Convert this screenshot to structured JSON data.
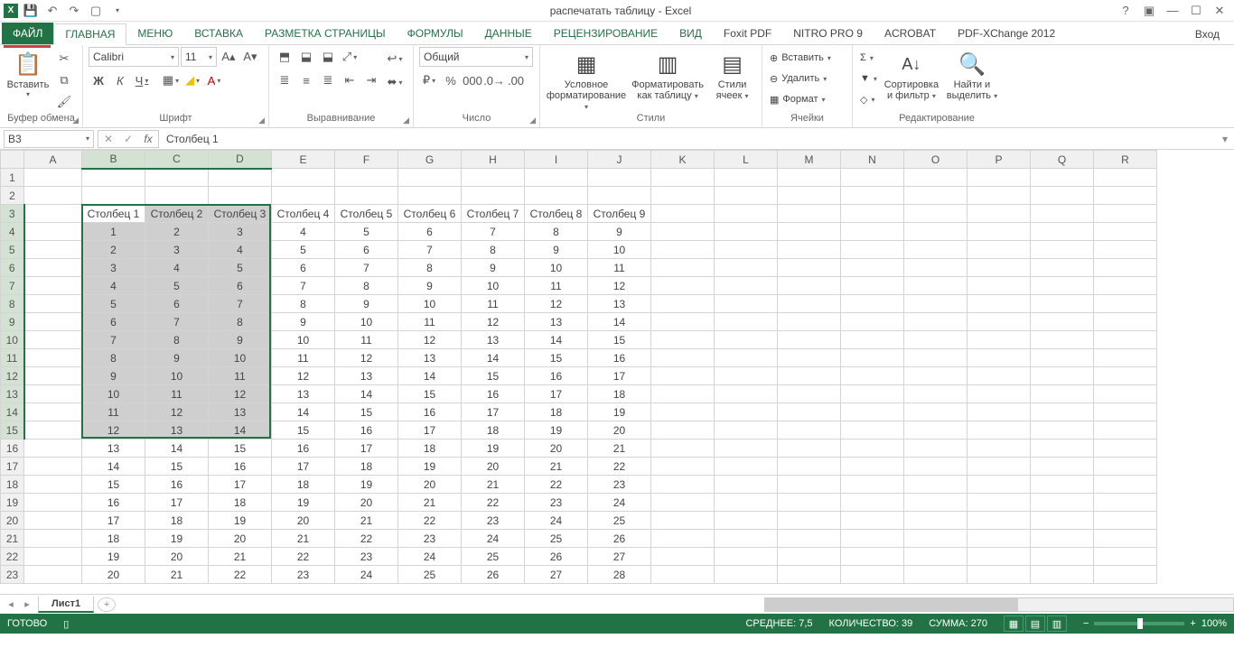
{
  "app": {
    "title": "распечатать таблицу - Excel"
  },
  "tabs": {
    "file": "ФАЙЛ",
    "home": "ГЛАВНАЯ",
    "menu": "Меню",
    "insert": "ВСТАВКА",
    "page_layout": "РАЗМЕТКА СТРАНИЦЫ",
    "formulas": "ФОРМУЛЫ",
    "data": "ДАННЫЕ",
    "review": "РЕЦЕНЗИРОВАНИЕ",
    "view": "ВИД",
    "foxit": "Foxit PDF",
    "nitro": "NITRO PRO 9",
    "acrobat": "ACROBAT",
    "pdfx": "PDF-XChange 2012",
    "signin": "Вход"
  },
  "ribbon": {
    "clipboard": {
      "paste": "Вставить",
      "label": "Буфер обмена"
    },
    "font": {
      "name": "Calibri",
      "size": "11",
      "label": "Шрифт",
      "bold": "Ж",
      "italic": "К",
      "underline": "Ч"
    },
    "alignment": {
      "label": "Выравнивание"
    },
    "number": {
      "format": "Общий",
      "label": "Число"
    },
    "styles": {
      "cond": "Условное форматирование",
      "table": "Форматировать как таблицу",
      "cell": "Стили ячеек",
      "label": "Стили"
    },
    "cells": {
      "insert": "Вставить",
      "delete": "Удалить",
      "format": "Формат",
      "label": "Ячейки"
    },
    "editing": {
      "sort": "Сортировка и фильтр",
      "find": "Найти и выделить",
      "label": "Редактирование"
    }
  },
  "formula_bar": {
    "name_box": "B3",
    "formula": "Столбец 1"
  },
  "columns": [
    "A",
    "B",
    "C",
    "D",
    "E",
    "F",
    "G",
    "H",
    "I",
    "J",
    "K",
    "L",
    "M",
    "N",
    "O",
    "P",
    "Q",
    "R"
  ],
  "selected_cols": [
    "B",
    "C",
    "D"
  ],
  "selected_rows_from": 3,
  "selected_rows_to": 15,
  "headers": [
    "Столбец 1",
    "Столбец 2",
    "Столбец 3",
    "Столбец 4",
    "Столбец 5",
    "Столбец 6",
    "Столбец 7",
    "Столбец 8",
    "Столбец 9"
  ],
  "data_start_row": 4,
  "data_end_row": 23,
  "data_first_values": [
    1,
    2,
    3,
    4,
    5,
    6,
    7,
    8,
    9
  ],
  "sheet": {
    "name": "Лист1"
  },
  "status": {
    "ready": "ГОТОВО",
    "avg_label": "СРЕДНЕЕ:",
    "avg": "7,5",
    "count_label": "КОЛИЧЕСТВО:",
    "count": "39",
    "sum_label": "СУММА:",
    "sum": "270",
    "zoom": "100%"
  }
}
